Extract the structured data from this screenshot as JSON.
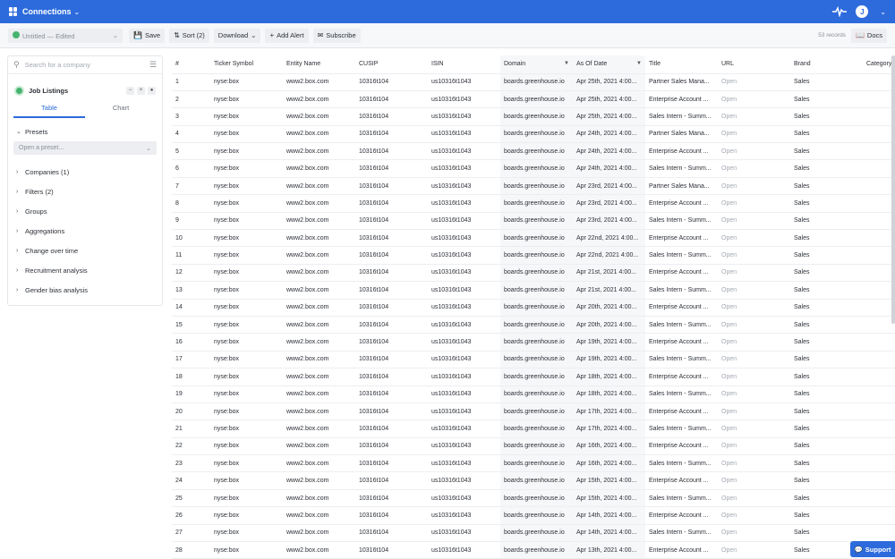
{
  "topbar": {
    "title": "Connections",
    "avatar": "J"
  },
  "toolbar": {
    "doc_title": "Untitled — Edited",
    "sort": "Sort (2)",
    "save": "Save",
    "download": "Download",
    "add_alert": "Add Alert",
    "subscribe": "Subscribe",
    "records": "53 records",
    "docs": "Docs"
  },
  "sidebar": {
    "search_placeholder": "Search for a company",
    "dataset_title": "Job Listings",
    "tabs": [
      "Table",
      "Chart"
    ],
    "presets_label": "Presets",
    "preset_placeholder": "Open a preset...",
    "sections": [
      "Companies (1)",
      "Filters (2)",
      "Groups",
      "Aggregations",
      "Change over time",
      "Recruitment analysis",
      "Gender bias analysis"
    ]
  },
  "table": {
    "columns": [
      "#",
      "Ticker Symbol",
      "Entity Name",
      "CUSIP",
      "ISIN",
      "Domain",
      "As Of Date",
      "Title",
      "URL",
      "Brand",
      "Category"
    ],
    "rows": [
      [
        "1",
        "nyse:box",
        "www2.box.com",
        "10316t104",
        "us10316t1043",
        "boards.greenhouse.io",
        "Apr 25th, 2021 4:00...",
        "Partner Sales Mana...",
        "Open",
        "Sales"
      ],
      [
        "2",
        "nyse:box",
        "www2.box.com",
        "10316t104",
        "us10316t1043",
        "boards.greenhouse.io",
        "Apr 25th, 2021 4:00...",
        "Enterprise Account ...",
        "Open",
        "Sales"
      ],
      [
        "3",
        "nyse:box",
        "www2.box.com",
        "10316t104",
        "us10316t1043",
        "boards.greenhouse.io",
        "Apr 25th, 2021 4:00...",
        "Sales Intern - Summ...",
        "Open",
        "Sales"
      ],
      [
        "4",
        "nyse:box",
        "www2.box.com",
        "10316t104",
        "us10316t1043",
        "boards.greenhouse.io",
        "Apr 24th, 2021 4:00...",
        "Partner Sales Mana...",
        "Open",
        "Sales"
      ],
      [
        "5",
        "nyse:box",
        "www2.box.com",
        "10316t104",
        "us10316t1043",
        "boards.greenhouse.io",
        "Apr 24th, 2021 4:00...",
        "Enterprise Account ...",
        "Open",
        "Sales"
      ],
      [
        "6",
        "nyse:box",
        "www2.box.com",
        "10316t104",
        "us10316t1043",
        "boards.greenhouse.io",
        "Apr 24th, 2021 4:00...",
        "Sales Intern - Summ...",
        "Open",
        "Sales"
      ],
      [
        "7",
        "nyse:box",
        "www2.box.com",
        "10316t104",
        "us10316t1043",
        "boards.greenhouse.io",
        "Apr 23rd, 2021 4:00...",
        "Partner Sales Mana...",
        "Open",
        "Sales"
      ],
      [
        "8",
        "nyse:box",
        "www2.box.com",
        "10316t104",
        "us10316t1043",
        "boards.greenhouse.io",
        "Apr 23rd, 2021 4:00...",
        "Enterprise Account ...",
        "Open",
        "Sales"
      ],
      [
        "9",
        "nyse:box",
        "www2.box.com",
        "10316t104",
        "us10316t1043",
        "boards.greenhouse.io",
        "Apr 23rd, 2021 4:00...",
        "Sales Intern - Summ...",
        "Open",
        "Sales"
      ],
      [
        "10",
        "nyse:box",
        "www2.box.com",
        "10316t104",
        "us10316t1043",
        "boards.greenhouse.io",
        "Apr 22nd, 2021 4:00...",
        "Enterprise Account ...",
        "Open",
        "Sales"
      ],
      [
        "11",
        "nyse:box",
        "www2.box.com",
        "10316t104",
        "us10316t1043",
        "boards.greenhouse.io",
        "Apr 22nd, 2021 4:00...",
        "Sales Intern - Summ...",
        "Open",
        "Sales"
      ],
      [
        "12",
        "nyse:box",
        "www2.box.com",
        "10316t104",
        "us10316t1043",
        "boards.greenhouse.io",
        "Apr 21st, 2021 4:00...",
        "Enterprise Account ...",
        "Open",
        "Sales"
      ],
      [
        "13",
        "nyse:box",
        "www2.box.com",
        "10316t104",
        "us10316t1043",
        "boards.greenhouse.io",
        "Apr 21st, 2021 4:00...",
        "Sales Intern - Summ...",
        "Open",
        "Sales"
      ],
      [
        "14",
        "nyse:box",
        "www2.box.com",
        "10316t104",
        "us10316t1043",
        "boards.greenhouse.io",
        "Apr 20th, 2021 4:00...",
        "Enterprise Account ...",
        "Open",
        "Sales"
      ],
      [
        "15",
        "nyse:box",
        "www2.box.com",
        "10316t104",
        "us10316t1043",
        "boards.greenhouse.io",
        "Apr 20th, 2021 4:00...",
        "Sales Intern - Summ...",
        "Open",
        "Sales"
      ],
      [
        "16",
        "nyse:box",
        "www2.box.com",
        "10316t104",
        "us10316t1043",
        "boards.greenhouse.io",
        "Apr 19th, 2021 4:00...",
        "Enterprise Account ...",
        "Open",
        "Sales"
      ],
      [
        "17",
        "nyse:box",
        "www2.box.com",
        "10316t104",
        "us10316t1043",
        "boards.greenhouse.io",
        "Apr 19th, 2021 4:00...",
        "Sales Intern - Summ...",
        "Open",
        "Sales"
      ],
      [
        "18",
        "nyse:box",
        "www2.box.com",
        "10316t104",
        "us10316t1043",
        "boards.greenhouse.io",
        "Apr 18th, 2021 4:00...",
        "Enterprise Account ...",
        "Open",
        "Sales"
      ],
      [
        "19",
        "nyse:box",
        "www2.box.com",
        "10316t104",
        "us10316t1043",
        "boards.greenhouse.io",
        "Apr 18th, 2021 4:00...",
        "Sales Intern - Summ...",
        "Open",
        "Sales"
      ],
      [
        "20",
        "nyse:box",
        "www2.box.com",
        "10316t104",
        "us10316t1043",
        "boards.greenhouse.io",
        "Apr 17th, 2021 4:00...",
        "Enterprise Account ...",
        "Open",
        "Sales"
      ],
      [
        "21",
        "nyse:box",
        "www2.box.com",
        "10316t104",
        "us10316t1043",
        "boards.greenhouse.io",
        "Apr 17th, 2021 4:00...",
        "Sales Intern - Summ...",
        "Open",
        "Sales"
      ],
      [
        "22",
        "nyse:box",
        "www2.box.com",
        "10316t104",
        "us10316t1043",
        "boards.greenhouse.io",
        "Apr 16th, 2021 4:00...",
        "Enterprise Account ...",
        "Open",
        "Sales"
      ],
      [
        "23",
        "nyse:box",
        "www2.box.com",
        "10316t104",
        "us10316t1043",
        "boards.greenhouse.io",
        "Apr 16th, 2021 4:00...",
        "Sales Intern - Summ...",
        "Open",
        "Sales"
      ],
      [
        "24",
        "nyse:box",
        "www2.box.com",
        "10316t104",
        "us10316t1043",
        "boards.greenhouse.io",
        "Apr 15th, 2021 4:00...",
        "Enterprise Account ...",
        "Open",
        "Sales"
      ],
      [
        "25",
        "nyse:box",
        "www2.box.com",
        "10316t104",
        "us10316t1043",
        "boards.greenhouse.io",
        "Apr 15th, 2021 4:00...",
        "Sales Intern - Summ...",
        "Open",
        "Sales"
      ],
      [
        "26",
        "nyse:box",
        "www2.box.com",
        "10316t104",
        "us10316t1043",
        "boards.greenhouse.io",
        "Apr 14th, 2021 4:00...",
        "Enterprise Account ...",
        "Open",
        "Sales"
      ],
      [
        "27",
        "nyse:box",
        "www2.box.com",
        "10316t104",
        "us10316t1043",
        "boards.greenhouse.io",
        "Apr 14th, 2021 4:00...",
        "Sales Intern - Summ...",
        "Open",
        "Sales"
      ],
      [
        "28",
        "nyse:box",
        "www2.box.com",
        "10316t104",
        "us10316t1043",
        "boards.greenhouse.io",
        "Apr 13th, 2021 4:00...",
        "Enterprise Account ...",
        "Open",
        "Sales"
      ]
    ]
  },
  "support": {
    "label": "Support"
  },
  "colors": {
    "accent": "#2d6bdc",
    "dataset": "#46b36e"
  }
}
